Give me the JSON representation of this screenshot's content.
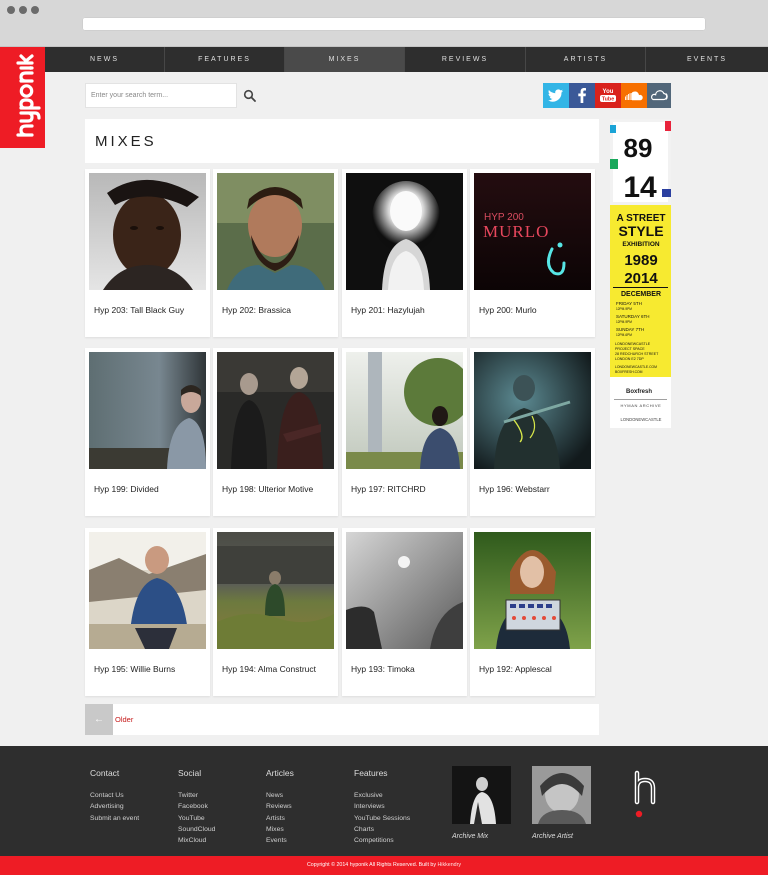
{
  "nav": {
    "items": [
      "NEWS",
      "FEATURES",
      "MIXES",
      "REVIEWS",
      "ARTISTS",
      "EVENTS"
    ],
    "active": "MIXES"
  },
  "brand": {
    "logo_text": "hyponik",
    "color": "#ee1c25"
  },
  "search": {
    "placeholder": "Enter your search term..."
  },
  "social": {
    "items": [
      {
        "name": "twitter",
        "color": "#33b5e6"
      },
      {
        "name": "facebook",
        "color": "#3b5998"
      },
      {
        "name": "youtube",
        "color": "#d9221c"
      },
      {
        "name": "soundcloud",
        "color": "#f77000"
      },
      {
        "name": "mixcloud",
        "color": "#52677a"
      }
    ]
  },
  "page_title": "MIXES",
  "mixes": [
    {
      "title": "Hyp 203: Tall Black Guy"
    },
    {
      "title": "Hyp 202: Brassica"
    },
    {
      "title": "Hyp 201: Hazylujah"
    },
    {
      "title": "Hyp 200: Murlo",
      "art_text": "HYP 200",
      "art_big": "MURLO"
    },
    {
      "title": "Hyp 199: Divided"
    },
    {
      "title": "Hyp 198: Ulterior Motive"
    },
    {
      "title": "Hyp 197: RITCHRD"
    },
    {
      "title": "Hyp 196: Webstarr"
    },
    {
      "title": "Hyp 195: Willie Burns"
    },
    {
      "title": "Hyp 194: Alma Construct"
    },
    {
      "title": "Hyp 193: Timoka"
    },
    {
      "title": "Hyp 192: Applescal"
    }
  ],
  "pager": {
    "arrow": "←",
    "older": "Older"
  },
  "ad": {
    "years_top": [
      "89",
      "14"
    ],
    "headline": [
      "A STREET",
      "STYLE",
      "EXHIBITION"
    ],
    "years": [
      "1989",
      "2014"
    ],
    "month": "DECEMBER",
    "dates": [
      "FRIDAY 5TH",
      "12PM-9PM",
      "SATURDAY 6TH",
      "12PM-9PM",
      "SUNDAY 7TH",
      "12PM-6PM"
    ],
    "venue": [
      "LONDONEWCASTLE",
      "PROJECT SPACE",
      "28 REDCHURCH STREET",
      "LONDON E2 7DP"
    ],
    "links": [
      "LONDONEWCASTLE.COM",
      "BOXFRESH.COM"
    ],
    "sponsor": "Boxfresh",
    "archive": "HYMAN ARCHIVE",
    "footer": "LONDONEWCASTLE"
  },
  "footer": {
    "columns": [
      {
        "heading": "Contact",
        "links": [
          "Contact Us",
          "Advertising",
          "Submit an event"
        ]
      },
      {
        "heading": "Social",
        "links": [
          "Twitter",
          "Facebook",
          "YouTube",
          "SoundCloud",
          "MixCloud"
        ]
      },
      {
        "heading": "Articles",
        "links": [
          "News",
          "Reviews",
          "Artists",
          "Mixes",
          "Events"
        ]
      },
      {
        "heading": "Features",
        "links": [
          "Exclusive",
          "Interviews",
          "YouTube Sessions",
          "Charts",
          "Competitions"
        ]
      }
    ],
    "archive_mix": "Archive Mix",
    "archive_artist": "Archive Artist"
  },
  "copyright": {
    "text": "Copyright © 2014 hyponik All Rights Reserved. Built by",
    "author": "Hikkendry"
  }
}
